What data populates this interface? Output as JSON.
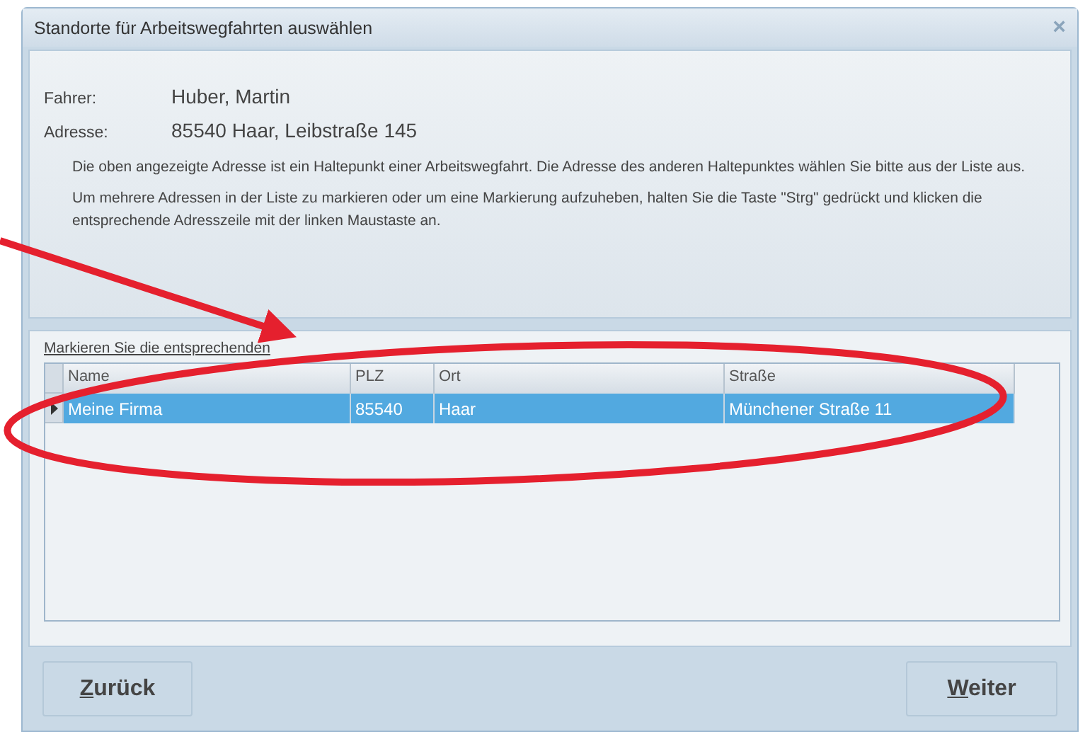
{
  "window": {
    "title": "Standorte für Arbeitswegfahrten auswählen",
    "close": "×"
  },
  "fields": [
    {
      "label": "Fahrer:",
      "value": "Huber, Martin"
    },
    {
      "label": "Adresse:",
      "value": "85540 Haar, Leibstraße 145"
    }
  ],
  "hints": [
    "Die oben angezeigte Adresse ist ein Haltepunkt einer Arbeitswegfahrt. Die Adresse des anderen Haltepunktes wählen Sie bitte aus der Liste aus.",
    "Um mehrere Adressen in der Liste zu markieren oder um eine Markierung aufzuheben, halten Sie die Taste \"Strg\" gedrückt und klicken die entsprechende Adresszeile mit der linken Maustaste an."
  ],
  "list_label": "Markieren Sie die entsprechenden",
  "table": {
    "columns": [
      "Name",
      "PLZ",
      "Ort",
      "Straße"
    ],
    "rows": [
      {
        "cells": [
          "Meine Firma",
          "85540",
          "Haar",
          "Münchener Straße 11"
        ],
        "selected": true
      }
    ]
  },
  "buttons": [
    {
      "label": "Zurück",
      "mnemonic_underlined": true
    },
    {
      "label": "Weiter",
      "mnemonic_underlined": true
    }
  ]
}
